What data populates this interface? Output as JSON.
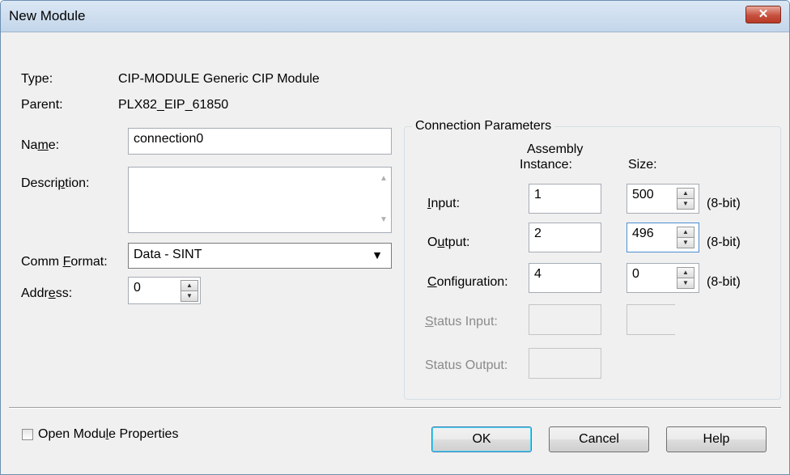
{
  "window": {
    "title": "New Module",
    "close_glyph": "✕"
  },
  "fields": {
    "type_label": "Type:",
    "type_value": "CIP-MODULE Generic CIP Module",
    "parent_label": "Parent:",
    "parent_value": "PLX82_EIP_61850",
    "name_label_pre": "Na",
    "name_label_ul": "m",
    "name_label_post": "e:",
    "name_value": "connection0",
    "description_label_pre": "Descri",
    "description_label_ul": "p",
    "description_label_post": "tion:",
    "description_value": "",
    "comm_format_label_pre": "Comm ",
    "comm_format_label_ul": "F",
    "comm_format_label_post": "ormat:",
    "comm_format_value": "Data - SINT",
    "address_label_pre": "Addr",
    "address_label_ul": "e",
    "address_label_post": "ss:",
    "address_value": "0"
  },
  "connection": {
    "legend": "Connection Parameters",
    "col_assembly_1": "Assembly",
    "col_assembly_2": "Instance:",
    "col_size": "Size:",
    "unit": "(8-bit)",
    "rows": [
      {
        "label_pre": "",
        "label_ul": "I",
        "label_post": "nput:",
        "instance": "1",
        "size": "500",
        "enabled": true
      },
      {
        "label_pre": "O",
        "label_ul": "u",
        "label_post": "tput:",
        "instance": "2",
        "size": "496",
        "enabled": true
      },
      {
        "label_pre": "",
        "label_ul": "C",
        "label_post": "onfiguration:",
        "instance": "4",
        "size": "0",
        "enabled": true
      },
      {
        "label_pre": "",
        "label_ul": "S",
        "label_post": "tatus Input:",
        "instance": "",
        "size": "",
        "enabled": false
      },
      {
        "label_pre": "Status Output:",
        "label_ul": "",
        "label_post": "",
        "instance": "",
        "enabled": false
      }
    ]
  },
  "footer": {
    "open_props_pre": "Open Modu",
    "open_props_ul": "l",
    "open_props_post": "e Properties",
    "open_props_checked": false,
    "ok": "OK",
    "cancel": "Cancel",
    "help": "Help"
  }
}
